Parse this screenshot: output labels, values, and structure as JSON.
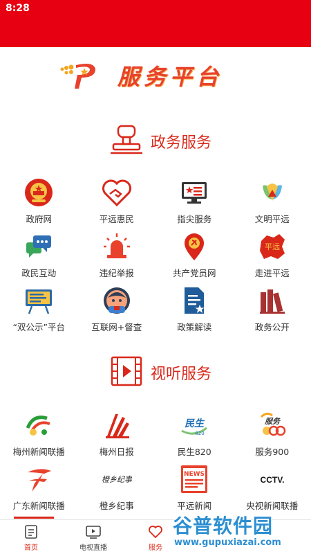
{
  "status_bar": {
    "time": "8:28"
  },
  "header": {
    "title": "服务平台"
  },
  "sections": {
    "gov": {
      "title": "政务服务",
      "items": [
        {
          "label": "政府网",
          "icon": "national-emblem-icon"
        },
        {
          "label": "平远惠民",
          "icon": "heart-handshake-icon"
        },
        {
          "label": "指尖服务",
          "icon": "monitor-flag-icon"
        },
        {
          "label": "文明平远",
          "icon": "civilization-leaf-icon"
        },
        {
          "label": "政民互动",
          "icon": "chat-bubbles-icon"
        },
        {
          "label": "违纪举报",
          "icon": "alarm-light-icon"
        },
        {
          "label": "共产党员网",
          "icon": "party-pin-icon"
        },
        {
          "label": "走进平远",
          "icon": "region-map-icon"
        },
        {
          "label": "“双公示”平台",
          "icon": "blackboard-icon"
        },
        {
          "label": "互联网+督查",
          "icon": "inspector-avatar-icon"
        },
        {
          "label": "政策解读",
          "icon": "document-star-icon"
        },
        {
          "label": "政务公开",
          "icon": "books-icon"
        }
      ]
    },
    "media": {
      "title": "视听服务",
      "items": [
        {
          "label": "梅州新闻联播",
          "icon": "meizhou-news-logo-icon"
        },
        {
          "label": "梅州日报",
          "icon": "meizhou-daily-logo-icon"
        },
        {
          "label": "民生820",
          "icon": "minsheng-820-logo-icon"
        },
        {
          "label": "服务900",
          "icon": "service-900-logo-icon"
        },
        {
          "label": "广东新闻联播",
          "icon": "guangdong-tv-logo-icon"
        },
        {
          "label": "橙乡纪事",
          "icon": "chengxiang-logo-icon"
        },
        {
          "label": "平远新闻",
          "icon": "news-logo-icon"
        },
        {
          "label": "央视新闻联播",
          "icon": "cctv-logo-icon"
        }
      ]
    }
  },
  "logos": {
    "cctv_text": "CCTV.",
    "news_text": "NEWS",
    "minsheng_text": "民生",
    "service_text": "服务",
    "chengxiang_text": "橙乡纪事"
  },
  "tabbar": [
    {
      "label": "首页",
      "icon": "home-doc-icon",
      "active": false
    },
    {
      "label": "电视直播",
      "icon": "tv-play-icon",
      "active": false
    },
    {
      "label": "服务",
      "icon": "heart-icon",
      "active": true
    }
  ],
  "watermark": {
    "title": "谷普软件园",
    "url": "www.gupuxiazai.com"
  },
  "colors": {
    "brand_red": "#e60012",
    "accent_red": "#d9281a",
    "title_orange": "#e8412c",
    "watermark_blue": "#2c8fd1"
  }
}
